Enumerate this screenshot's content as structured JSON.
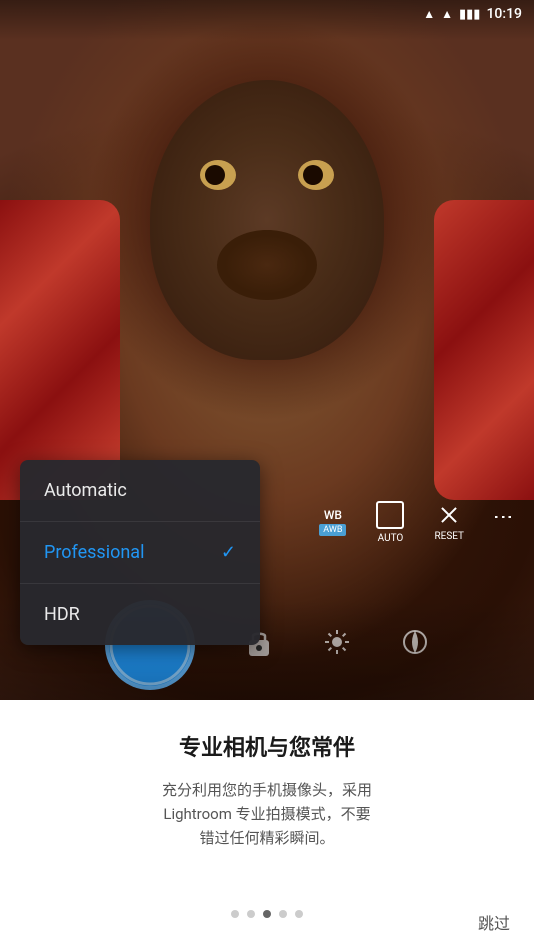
{
  "statusBar": {
    "time": "10:19",
    "batteryIcon": "🔋",
    "wifiIcon": "▲"
  },
  "camera": {
    "wbLabel": "WB",
    "wbBadge": "AWB",
    "autoLabel": "AUTO",
    "resetLabel": "RESET"
  },
  "dropdown": {
    "items": [
      {
        "id": "automatic",
        "label": "Automatic",
        "active": false
      },
      {
        "id": "professional",
        "label": "Professional",
        "active": true
      },
      {
        "id": "hdr",
        "label": "HDR",
        "active": false
      }
    ]
  },
  "bottomSection": {
    "title": "专业相机与您常伴",
    "description": "充分利用您的手机摄像头，采用\nLightroom 专业拍摄模式，不要\n错过任何精彩瞬间。"
  },
  "pagination": {
    "dots": [
      false,
      false,
      true,
      false,
      false
    ],
    "currentIndex": 2
  },
  "skipButton": {
    "label": "跳过"
  }
}
